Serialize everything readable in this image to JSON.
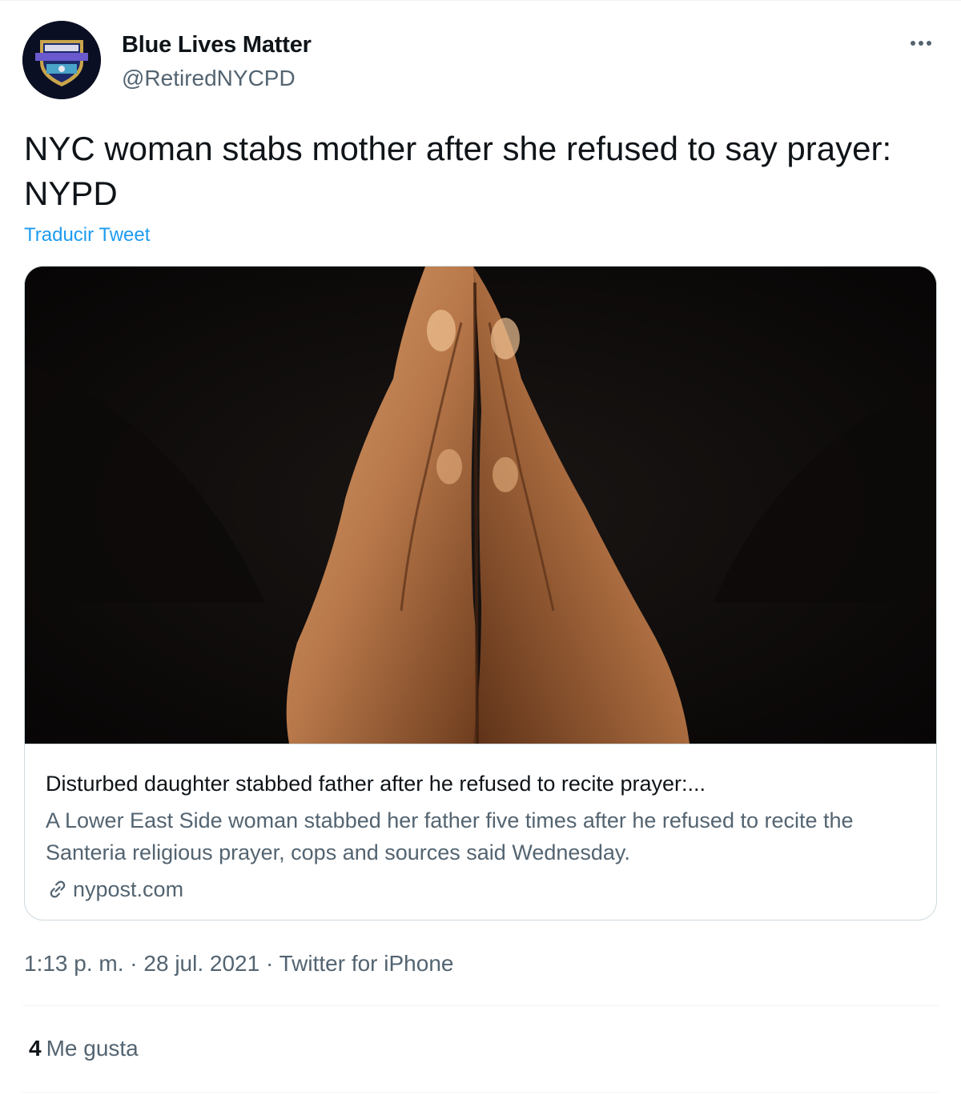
{
  "author": {
    "name": "Blue Lives Matter",
    "handle": "@RetiredNYCPD",
    "avatar_icon": "police-badge-icon"
  },
  "tweet": {
    "text": "NYC woman stabs mother after she refused to say prayer: NYPD",
    "translate_label": "Traducir Tweet"
  },
  "card": {
    "image_icon": "praying-hands-photo",
    "title": "Disturbed daughter stabbed father after he refused to recite prayer:...",
    "description": "A Lower East Side woman stabbed her father five times after he refused to recite the Santeria religious prayer, cops and sources said Wednesday.",
    "domain": "nypost.com"
  },
  "meta": {
    "time": "1:13 p. m.",
    "separator": "·",
    "date": "28 jul. 2021",
    "source": "Twitter for iPhone"
  },
  "stats": {
    "likes_count": "4",
    "likes_label": "Me gusta"
  },
  "colors": {
    "link": "#1d9bf0",
    "secondary_text": "#536471",
    "primary_text": "#0f1419",
    "border": "#cfd9de"
  }
}
